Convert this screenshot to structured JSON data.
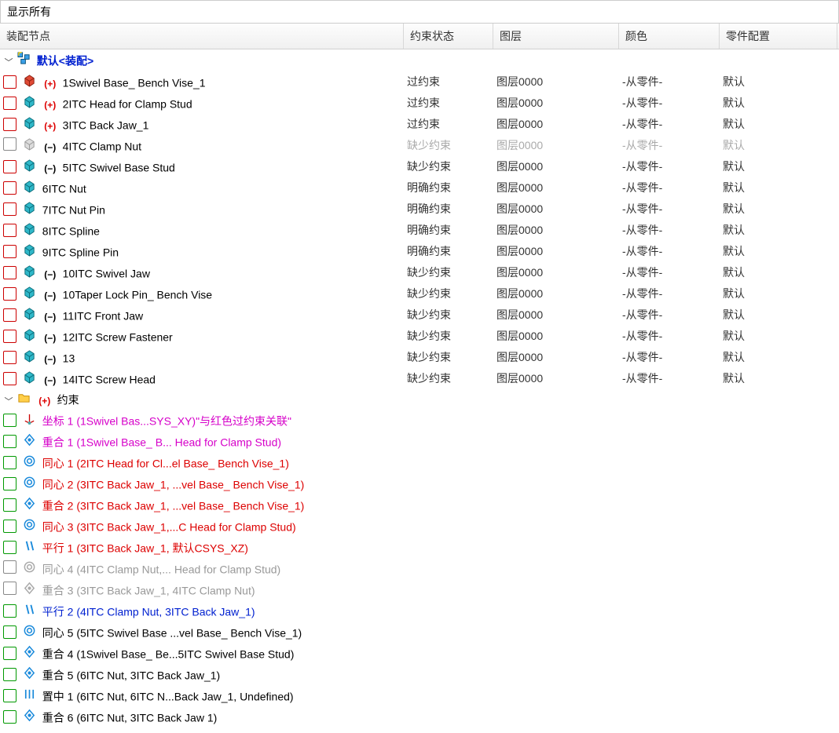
{
  "topbar": {
    "label": "显示所有"
  },
  "headers": {
    "node": "装配节点",
    "constraint": "约束状态",
    "layer": "图层",
    "color": "颜色",
    "config": "零件配置"
  },
  "root": {
    "label": "默认<装配>"
  },
  "parts": [
    {
      "check": "red",
      "part_icon": "red-cube",
      "status": "plus",
      "name": "1Swivel Base_ Bench Vise_1",
      "cons": "过约束",
      "layer": "图层0000",
      "color": "-从零件-",
      "conf": "默认",
      "disabled": false
    },
    {
      "check": "red",
      "part_icon": "cyan-cube",
      "status": "plus",
      "name": "2ITC Head for Clamp Stud",
      "cons": "过约束",
      "layer": "图层0000",
      "color": "-从零件-",
      "conf": "默认",
      "disabled": false
    },
    {
      "check": "red",
      "part_icon": "cyan-cube",
      "status": "plus",
      "name": "3ITC Back Jaw_1",
      "cons": "过约束",
      "layer": "图层0000",
      "color": "-从零件-",
      "conf": "默认",
      "disabled": false
    },
    {
      "check": "gray-empty",
      "part_icon": "gray-cube",
      "status": "minus",
      "name": "4ITC Clamp Nut",
      "cons": "缺少约束",
      "layer": "图层0000",
      "color": "-从零件-",
      "conf": "默认",
      "disabled": true
    },
    {
      "check": "red",
      "part_icon": "cyan-cube",
      "status": "minus",
      "name": "5ITC Swivel Base Stud",
      "cons": "缺少约束",
      "layer": "图层0000",
      "color": "-从零件-",
      "conf": "默认",
      "disabled": false
    },
    {
      "check": "red",
      "part_icon": "cyan-cube",
      "status": "",
      "name": "6ITC Nut",
      "cons": "明确约束",
      "layer": "图层0000",
      "color": "-从零件-",
      "conf": "默认",
      "disabled": false
    },
    {
      "check": "red",
      "part_icon": "cyan-cube",
      "status": "",
      "name": "7ITC Nut Pin",
      "cons": "明确约束",
      "layer": "图层0000",
      "color": "-从零件-",
      "conf": "默认",
      "disabled": false
    },
    {
      "check": "red",
      "part_icon": "cyan-cube",
      "status": "",
      "name": "8ITC Spline",
      "cons": "明确约束",
      "layer": "图层0000",
      "color": "-从零件-",
      "conf": "默认",
      "disabled": false
    },
    {
      "check": "red",
      "part_icon": "cyan-cube",
      "status": "",
      "name": "9ITC Spline Pin",
      "cons": "明确约束",
      "layer": "图层0000",
      "color": "-从零件-",
      "conf": "默认",
      "disabled": false
    },
    {
      "check": "red",
      "part_icon": "cyan-cube",
      "status": "minus",
      "name": "10ITC Swivel Jaw",
      "cons": "缺少约束",
      "layer": "图层0000",
      "color": "-从零件-",
      "conf": "默认",
      "disabled": false
    },
    {
      "check": "red",
      "part_icon": "cyan-cube",
      "status": "minus",
      "name": "10Taper Lock Pin_ Bench Vise",
      "cons": "缺少约束",
      "layer": "图层0000",
      "color": "-从零件-",
      "conf": "默认",
      "disabled": false
    },
    {
      "check": "red",
      "part_icon": "cyan-cube",
      "status": "minus",
      "name": "11ITC Front Jaw",
      "cons": "缺少约束",
      "layer": "图层0000",
      "color": "-从零件-",
      "conf": "默认",
      "disabled": false
    },
    {
      "check": "red",
      "part_icon": "cyan-cube",
      "status": "minus",
      "name": "12ITC Screw Fastener",
      "cons": "缺少约束",
      "layer": "图层0000",
      "color": "-从零件-",
      "conf": "默认",
      "disabled": false
    },
    {
      "check": "red",
      "part_icon": "cyan-cube",
      "status": "minus",
      "name": "13",
      "cons": "缺少约束",
      "layer": "图层0000",
      "color": "-从零件-",
      "conf": "默认",
      "disabled": false
    },
    {
      "check": "red",
      "part_icon": "cyan-cube",
      "status": "minus",
      "name": "14ITC Screw Head",
      "cons": "缺少约束",
      "layer": "图层0000",
      "color": "-从零件-",
      "conf": "默认",
      "disabled": false
    }
  ],
  "constraints_folder": {
    "status": "plus",
    "label": "约束"
  },
  "constraints": [
    {
      "check": "green",
      "cicon": "coord",
      "text": "坐标 1 (1Swivel Bas...SYS_XY)\"与红色过约束关联\"",
      "color": "magenta"
    },
    {
      "check": "green",
      "cicon": "coincident",
      "text": "重合 1 (1Swivel Base_ B... Head for Clamp Stud)",
      "color": "magenta"
    },
    {
      "check": "green",
      "cicon": "concentric",
      "text": "同心 1 (2ITC Head for Cl...el Base_ Bench Vise_1)",
      "color": "red"
    },
    {
      "check": "green",
      "cicon": "concentric",
      "text": "同心 2 (3ITC Back Jaw_1, ...vel Base_ Bench Vise_1)",
      "color": "red"
    },
    {
      "check": "green",
      "cicon": "coincident",
      "text": "重合 2 (3ITC Back Jaw_1, ...vel Base_ Bench Vise_1)",
      "color": "red"
    },
    {
      "check": "green",
      "cicon": "concentric",
      "text": "同心 3 (3ITC Back Jaw_1,...C Head for Clamp Stud)",
      "color": "red"
    },
    {
      "check": "green",
      "cicon": "parallel",
      "text": "平行 1 (3ITC Back Jaw_1, 默认CSYS_XZ)",
      "color": "red"
    },
    {
      "check": "empty",
      "cicon": "concentric-gray",
      "text": "同心 4 (4ITC Clamp Nut,... Head for Clamp Stud)",
      "color": "gray"
    },
    {
      "check": "empty",
      "cicon": "coincident-gray",
      "text": "重合 3 (3ITC Back Jaw_1, 4ITC Clamp Nut)",
      "color": "gray"
    },
    {
      "check": "green",
      "cicon": "parallel",
      "text": "平行 2 (4ITC Clamp Nut, 3ITC Back Jaw_1)",
      "color": "blue"
    },
    {
      "check": "green",
      "cicon": "concentric",
      "text": "同心 5 (5ITC Swivel Base ...vel Base_ Bench Vise_1)",
      "color": "black"
    },
    {
      "check": "green",
      "cicon": "coincident",
      "text": "重合 4 (1Swivel Base_ Be...5ITC Swivel Base Stud)",
      "color": "black"
    },
    {
      "check": "green",
      "cicon": "coincident",
      "text": "重合 5 (6ITC Nut, 3ITC Back Jaw_1)",
      "color": "black"
    },
    {
      "check": "green",
      "cicon": "center",
      "text": "置中 1 (6ITC Nut, 6ITC N...Back Jaw_1, Undefined)",
      "color": "black"
    },
    {
      "check": "green",
      "cicon": "coincident",
      "text": "重合 6 (6ITC Nut, 3ITC Back Jaw 1)",
      "color": "black"
    }
  ]
}
